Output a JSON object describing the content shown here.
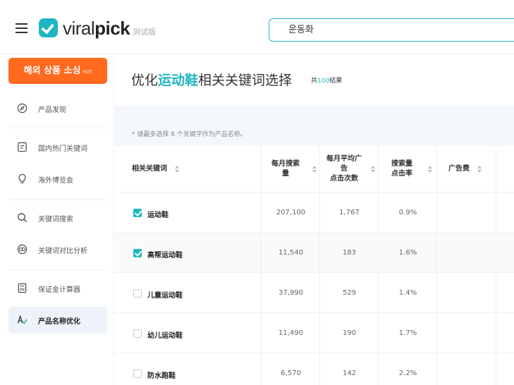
{
  "header": {
    "logo_light": "viral",
    "logo_bold": "pick",
    "logo_badge": "测试版",
    "search_value": "운동화"
  },
  "sidebar": {
    "promo_label": "해외 상품 소싱",
    "promo_badge": "HOT",
    "items": [
      {
        "label": "产品发现",
        "icon": "compass-icon"
      },
      {
        "label": "国内热门关键词",
        "icon": "list-icon"
      },
      {
        "label": "海外博览会",
        "icon": "lightbulb-icon"
      },
      {
        "label": "关键词搜索",
        "icon": "search-icon"
      },
      {
        "label": "关键词对比分析",
        "icon": "compare-icon"
      },
      {
        "label": "保证金计算器",
        "icon": "calculator-icon"
      },
      {
        "label": "产品名称优化",
        "icon": "text-check-icon",
        "active": true
      }
    ]
  },
  "main": {
    "title_prefix": "优化",
    "title_keyword": "运动鞋",
    "title_suffix": "相关关键词选择",
    "count_prefix": "共",
    "count_value": "100",
    "count_suffix": "结果",
    "notice": "* 请最多选择 8 个关键字作为产品名称。",
    "columns": [
      {
        "line1": "相关关键词",
        "line2": "",
        "line3": ""
      },
      {
        "line1": "每月搜索",
        "line2": "量",
        "line3": ""
      },
      {
        "line1": "每月平均广",
        "line2": "告",
        "line3": "点击次数"
      },
      {
        "line1": "搜索量",
        "line2": "点击率",
        "line3": ""
      },
      {
        "line1": "广告费",
        "line2": "",
        "line3": ""
      }
    ],
    "rows": [
      {
        "keyword": "运动鞋",
        "checked": true,
        "searches": "207,100",
        "clicks": "1,767",
        "ctr": "0.9%"
      },
      {
        "keyword": "高帮运动鞋",
        "checked": true,
        "searches": "11,540",
        "clicks": "183",
        "ctr": "1.6%"
      },
      {
        "keyword": "儿童运动鞋",
        "checked": false,
        "searches": "37,990",
        "clicks": "529",
        "ctr": "1.4%"
      },
      {
        "keyword": "幼儿运动鞋",
        "checked": false,
        "searches": "11,490",
        "clicks": "190",
        "ctr": "1.7%"
      },
      {
        "keyword": "防水跑鞋",
        "checked": false,
        "searches": "6,570",
        "clicks": "142",
        "ctr": "2.2%"
      }
    ]
  },
  "colors": {
    "accent": "#1fb6c2",
    "promo": "#ff6a1f",
    "active_nav": "#eef2f9",
    "notice_bg": "#f4f7fb"
  }
}
